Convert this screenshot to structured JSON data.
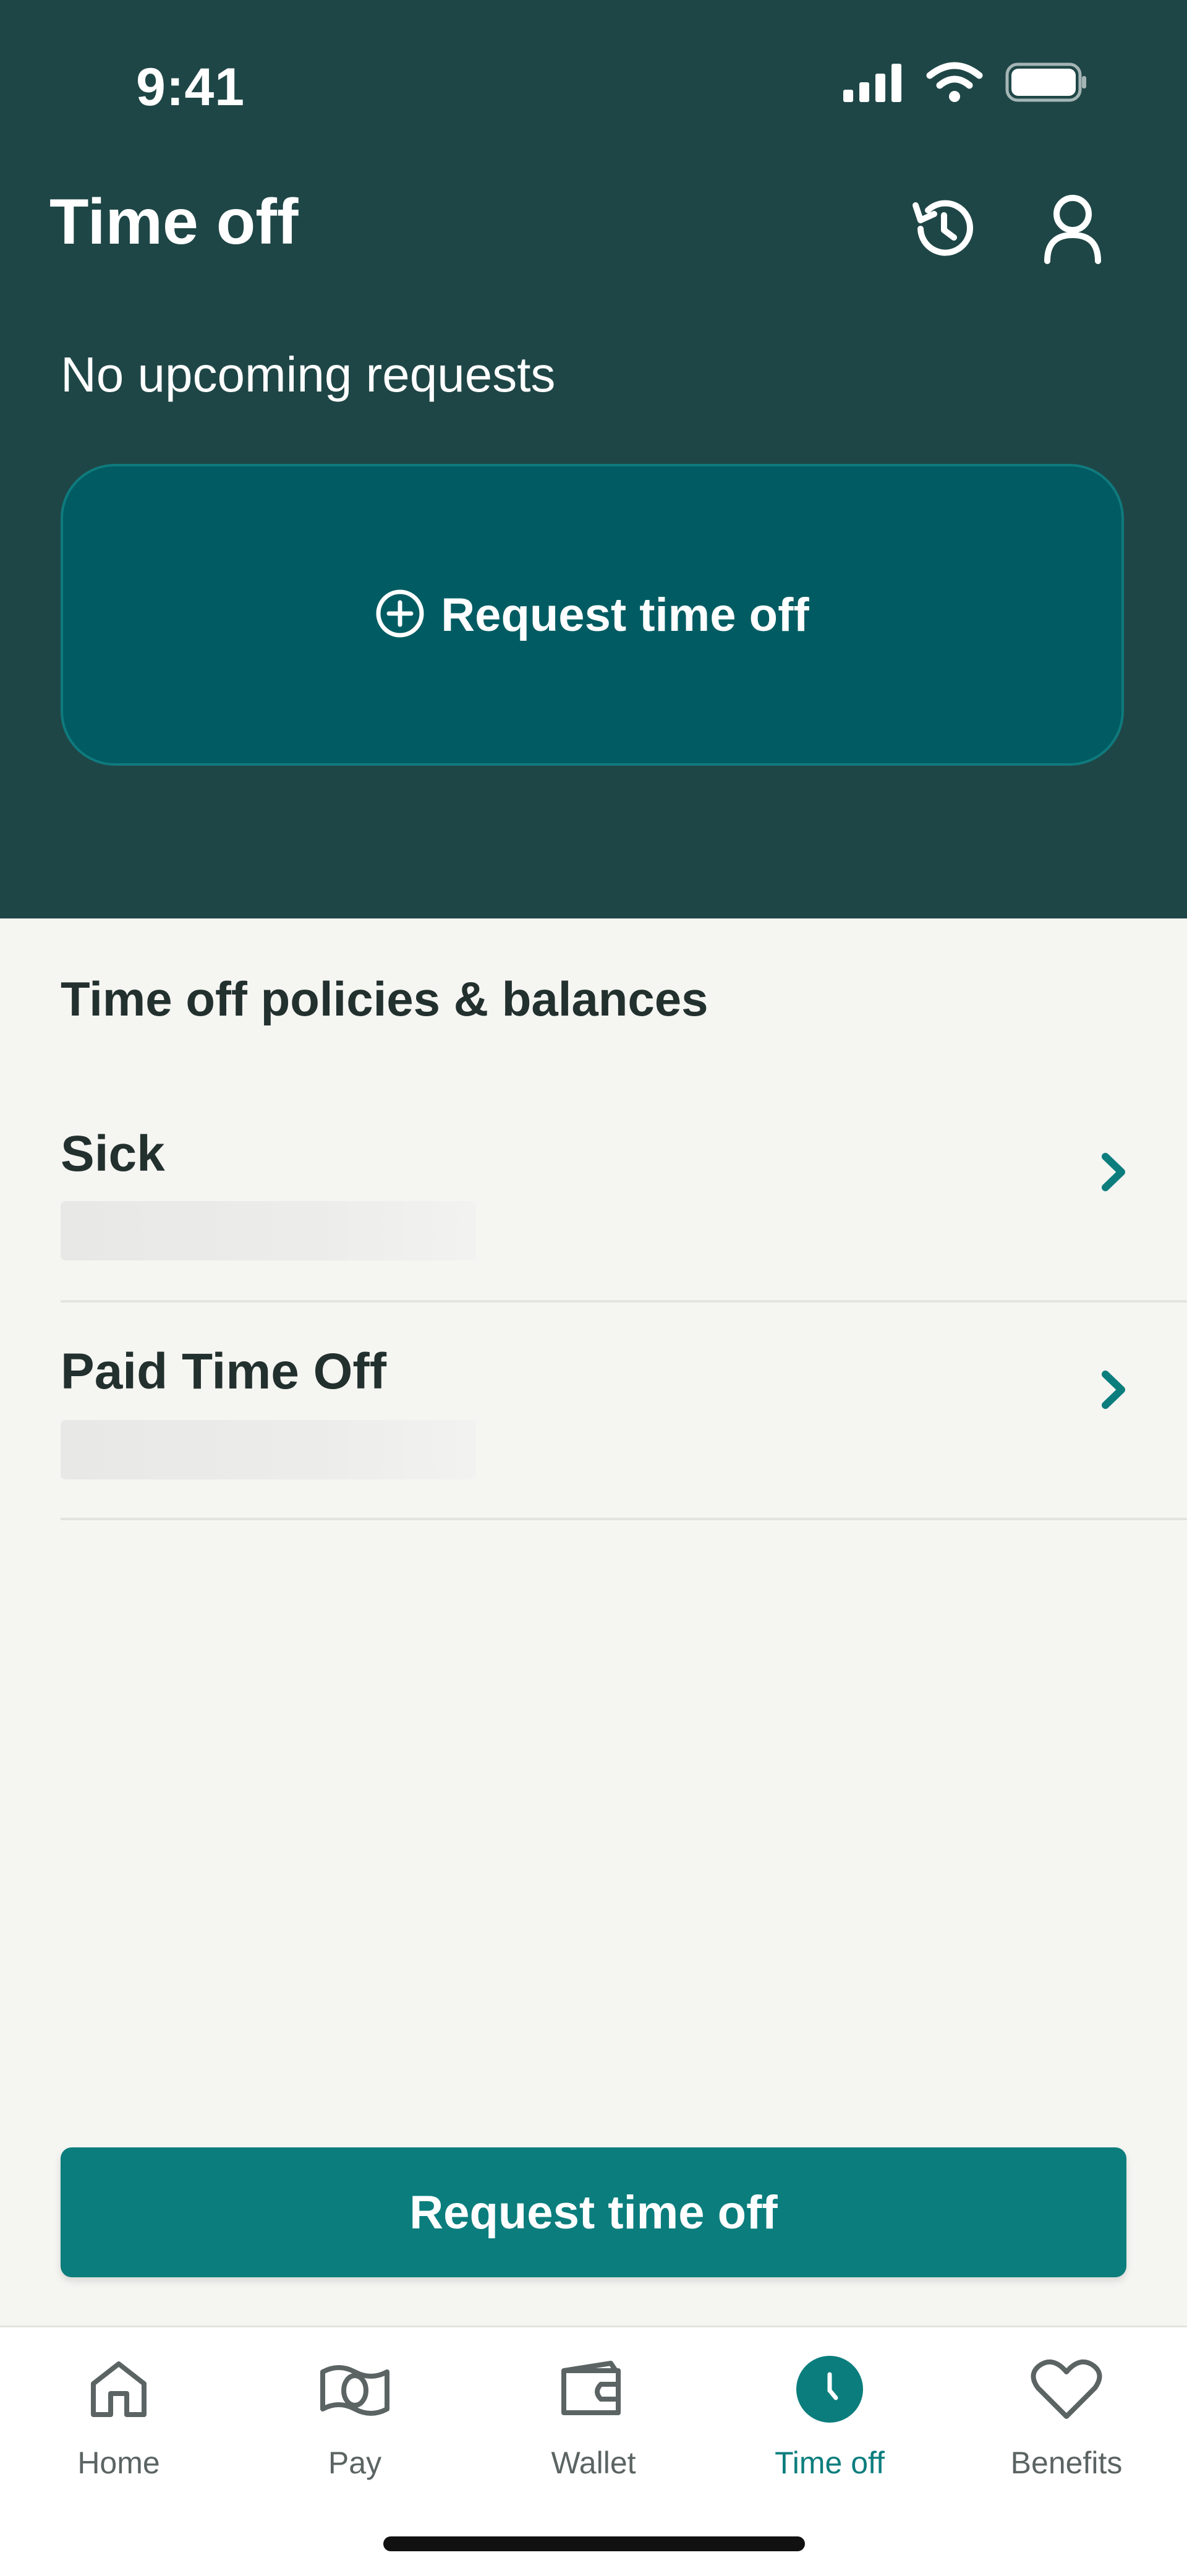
{
  "status_bar": {
    "time": "9:41"
  },
  "header": {
    "title": "Time off",
    "history_icon": "history-icon",
    "profile_icon": "profile-icon"
  },
  "upcoming": {
    "empty_text": "No upcoming requests",
    "request_card_label": "Request time off"
  },
  "policies": {
    "section_title": "Time off policies & balances",
    "items": [
      {
        "name": "Sick"
      },
      {
        "name": "Paid Time Off"
      }
    ]
  },
  "cta": {
    "label": "Request time off"
  },
  "tabs": [
    {
      "label": "Home",
      "icon": "home-icon"
    },
    {
      "label": "Pay",
      "icon": "pay-icon"
    },
    {
      "label": "Wallet",
      "icon": "wallet-icon"
    },
    {
      "label": "Time off",
      "icon": "clock-icon",
      "active": true
    },
    {
      "label": "Benefits",
      "icon": "heart-icon"
    }
  ],
  "colors": {
    "header_bg": "#1f4646",
    "card_bg": "#005c62",
    "accent": "#0b7d7d",
    "page_bg": "#f5f5f2"
  }
}
